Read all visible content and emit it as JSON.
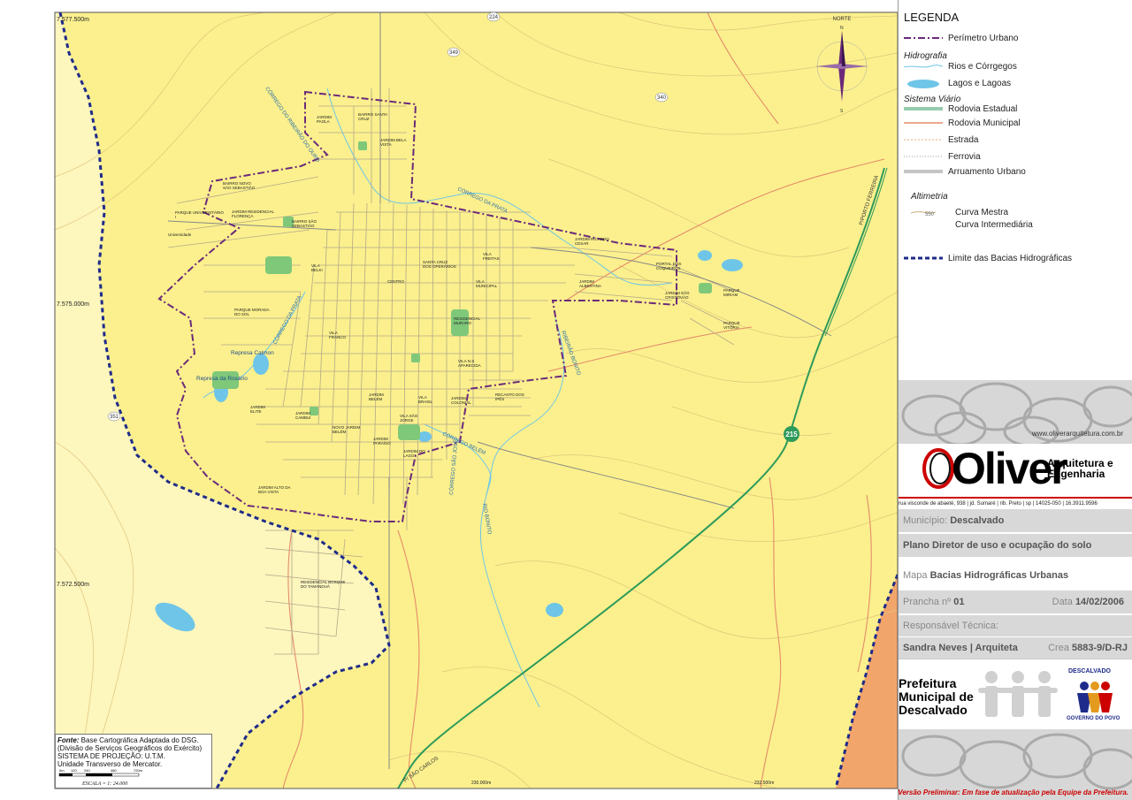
{
  "legend": {
    "title": "LEGENDA",
    "urban_perimeter": "Perímetro Urbano",
    "hydro_title": "Hidrografia",
    "rivers": "Rios e Córrgegos",
    "lakes": "Lagos e  Lagoas",
    "road_title": "Sistema Viário",
    "state_highway": "Rodovia Estadual",
    "municipal_highway": "Rodovia Municipal",
    "road": "Estrada",
    "railway": "Ferrovia",
    "urban_streets": "Arruamento Urbano",
    "alt_title": "Altimetria",
    "contour_label": "550",
    "master_contour": "Curva Mestra",
    "intermediate_contour": "Curva Intermediária",
    "basin_limit": "Limite das Bacias Hidrográficas"
  },
  "compass": {
    "north": "NORTE",
    "n": "N",
    "s": "S"
  },
  "map": {
    "coord_y1": "7.577.500m",
    "coord_y2": "7.575.000m",
    "coord_y3": "7.572.500m",
    "coord_x1": "230.000m",
    "coord_x2": "232.500m",
    "route_224": "224",
    "route_349": "349",
    "route_340": "340",
    "route_351": "351",
    "route_215": "215",
    "road_porto_ferreira": "P/PORTO FERREIRA",
    "road_sao_carlos": "P/ SÃO CARLOS",
    "creek_ribeirao_ouro": "CÓRREGO DO RIBEIRÃO DO OURO",
    "creek_da_prata": "CÓRREGO DA PRATA",
    "creek_da_prata2": "CÓRREGO DA PRATA",
    "ribeirao_bonito": "RIBEIRÃO BONITO",
    "rio_bonito": "RIO BONITO",
    "creek_belem": "CÓRREGO BELÉM",
    "creek_sao_jose": "CÓRREGO SÃO JOSÉ",
    "represa_calmon": "Represa Calmon",
    "represa_rosario": "Represa da Rosário",
    "neighborhoods": [
      "JARDIM PAOLA",
      "BAIRRO SANTA CRUZ",
      "JARDIM BELA VISTA",
      "BAIRRO NOVO SÃO SEBASTIÃO",
      "PARQUE UNIVERSITÁRIO I",
      "JARDIM RESIDENCIAL FLORENÇA",
      "BAIRRO SÃO SEBASTIÃO",
      "Universidade",
      "VILA BELKI",
      "CENTRO",
      "SANTA CRUZ DOS OPERÁRIOS",
      "VILA FREITAS",
      "JARDIM RICARDO CESAR",
      "PORTAL DOS COQUEIROS",
      "JARDIM ALBERTINA",
      "JARDIM SÃO CRISTÓVÃO",
      "PARQUE MIRIAM",
      "PARQUE VITÓRIA",
      "VILA MUNICIPAL",
      "RESIDENCIAL MURARO",
      "PARQUE MORADA DO SOL",
      "VILA FRANCO",
      "VILA N.S. APARECIDA",
      "RECANTO DOS IPÊS",
      "JARDIM COLONIAL",
      "VILA BRASIL",
      "JARDIM BELÉM",
      "JARDIM ELITE",
      "JARDIM CAMBUÍ",
      "NOVO JARDIM BELÉM",
      "VILA SÃO JORGE",
      "JARDIM PARAÍSO",
      "JARDIM DO LAGO",
      "JARDIM ALTO DA BOA VISTA",
      "RESIDENCIAL BOSQUE DO TAMANDUÁ"
    ]
  },
  "notes": {
    "source_label": "Fonte:",
    "source": "Base Cartográfica Adaptada do DSG.",
    "source2": "(Divisão de Serviços Geográficos do Exército)",
    "projection": "SISTEMA DE PROJEÇÃO: U.T.M.",
    "projection2": "Unidade Transverso de Mercator.",
    "scale": "ESCALA = 1: 24.000",
    "scale_ticks": [
      "0m",
      "120",
      "240",
      "480",
      "720m"
    ]
  },
  "title_block": {
    "url": "www.oliverarquitetura.com.br",
    "logo": "Oliver",
    "logo_sub1": "Arquitetura e",
    "logo_sub2": "Engenharia",
    "address": "rua visconde de abaeté, 938 | jd. Sumaré | rib. Preto | sp | 14025-050 | 16.3911.9596",
    "municipio_label": "Município:",
    "municipio": "Descalvado",
    "plano": "Plano Diretor de uso e ocupação do solo",
    "mapa_label": "Mapa",
    "mapa": "Bacias Hidrográficas Urbanas",
    "prancha_label": "Prancha nº",
    "prancha": "01",
    "data_label": "Data",
    "data": "14/02/2006",
    "resp_label": "Responsável Técnica:",
    "resp": "Sandra Neves | Arquiteta",
    "crea_label": "Crea",
    "crea": "5883-9/D-RJ",
    "prefeitura": "Prefeitura Municipal de Descalvado",
    "descalvado_logo": "DESCALVADO",
    "governo": "GOVERNO DO POVO",
    "prelim": "Versão Preliminar:  Em fase de atualização pela Equipe da Prefeitura."
  },
  "colors": {
    "map_bg": "#fbf08d",
    "perimeter": "#6b2a7a",
    "basin": "#1f2b8a",
    "state_road": "#2e9a5b",
    "water": "#6ec5e8"
  }
}
